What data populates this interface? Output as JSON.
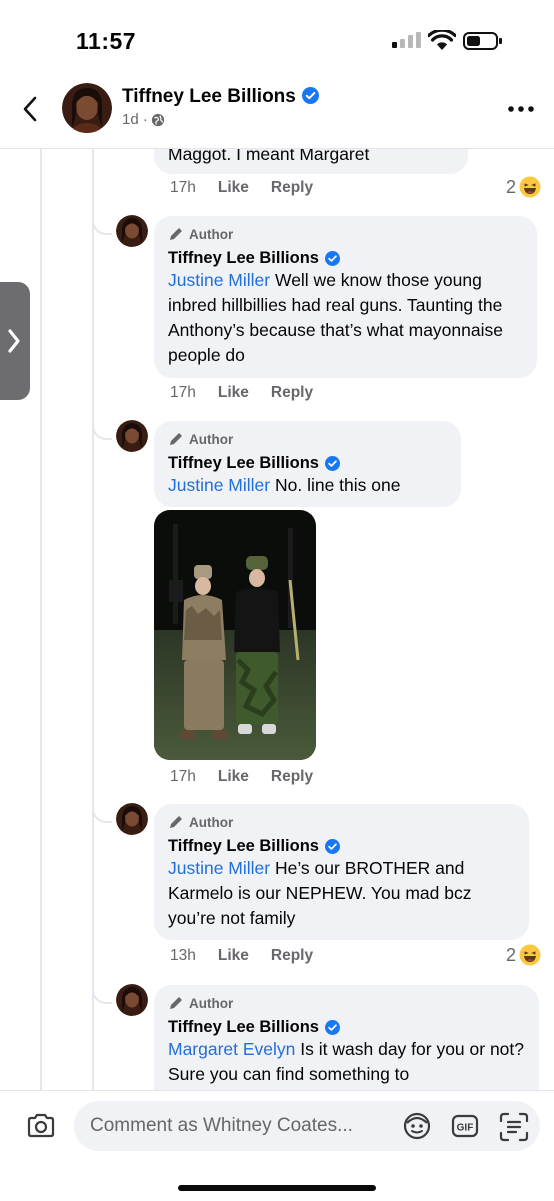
{
  "status_bar": {
    "time": "11:57"
  },
  "header": {
    "name": "Tiffney Lee Billions",
    "meta": "1d ·"
  },
  "comments": [
    {
      "partial_text": "Maggot. I meant Margaret",
      "time": "17h",
      "like": "Like",
      "reply": "Reply",
      "reaction_count": "2"
    },
    {
      "author_tag": "Author",
      "name": "Tiffney Lee Billions",
      "mention": "Justine Miller",
      "text": " Well we know those young inbred  hillbillies had real guns. Taunting the Anthony’s because that’s what mayonnaise people do",
      "time": "17h",
      "like": "Like",
      "reply": "Reply"
    },
    {
      "author_tag": "Author",
      "name": "Tiffney Lee Billions",
      "mention": "Justine Miller",
      "text": " No. line this one",
      "time": "17h",
      "like": "Like",
      "reply": "Reply"
    },
    {
      "author_tag": "Author",
      "name": "Tiffney Lee Billions",
      "mention": "Justine Miller",
      "text": " He’s our BROTHER and Karmelo is our NEPHEW. You mad bcz you’re not family",
      "time": "13h",
      "like": "Like",
      "reply": "Reply",
      "reaction_count": "2"
    },
    {
      "author_tag": "Author",
      "name": "Tiffney Lee Billions",
      "mention": "Margaret Evelyn",
      "text": " Is it wash day for you or not? Sure you can find something to"
    }
  ],
  "composer": {
    "placeholder": "Comment as Whitney Coates..."
  },
  "icons": [
    "back-icon",
    "verified-icon",
    "globe-icon",
    "more-icon",
    "pencil-icon",
    "haha-icon",
    "camera-icon",
    "avatar-sticker-icon",
    "gif-icon",
    "text-scan-icon",
    "chevron-right-icon"
  ],
  "colors": {
    "mention": "#216fdb",
    "verified": "#1877f2",
    "bubble": "#f0f2f5",
    "secondary_text": "#65676b"
  }
}
